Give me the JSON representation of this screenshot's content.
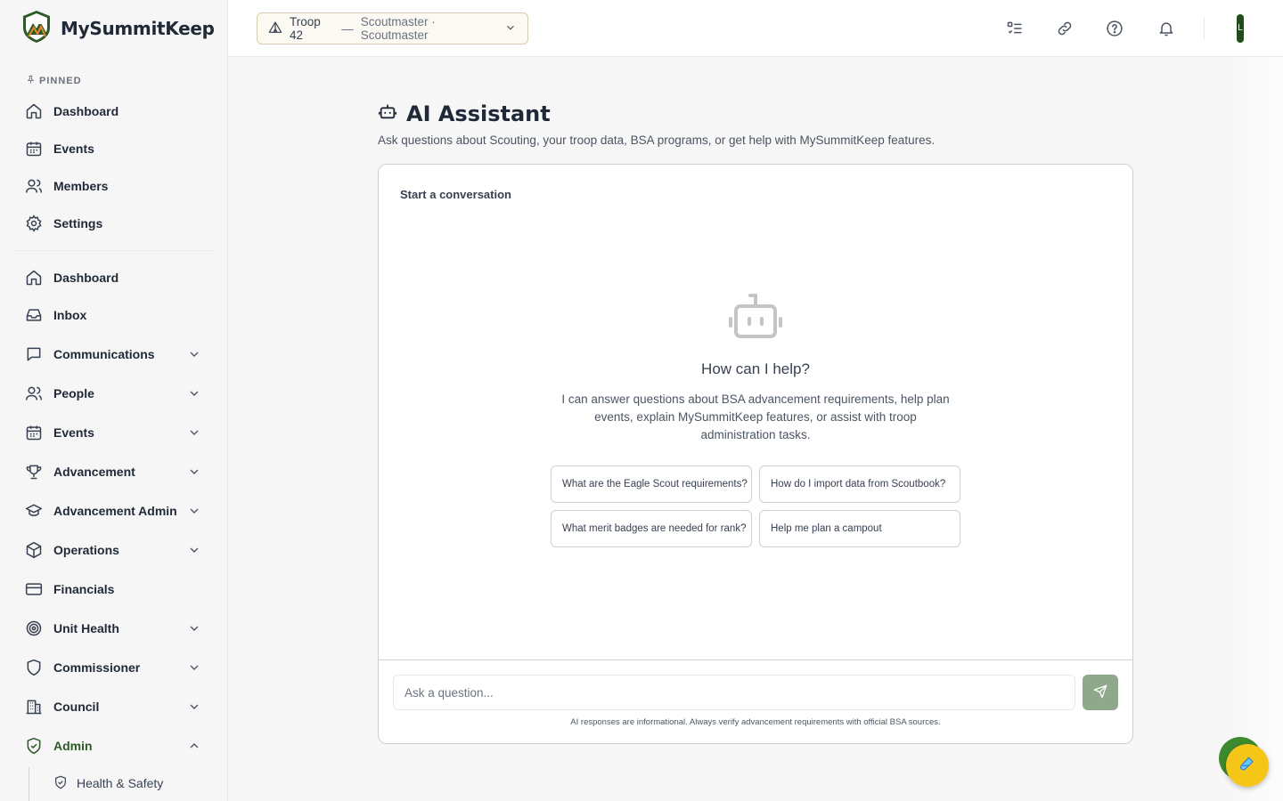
{
  "brand": {
    "name": "MySummitKeep"
  },
  "sidebar": {
    "pinned_label": "PINNED",
    "pinned": [
      {
        "label": "Dashboard",
        "icon": "home-icon"
      },
      {
        "label": "Events",
        "icon": "calendar-icon"
      },
      {
        "label": "Members",
        "icon": "users-icon"
      },
      {
        "label": "Settings",
        "icon": "gear-icon"
      }
    ],
    "items": [
      {
        "label": "Dashboard",
        "icon": "home-icon",
        "expandable": false
      },
      {
        "label": "Inbox",
        "icon": "inbox-icon",
        "expandable": false
      },
      {
        "label": "Communications",
        "icon": "message-icon",
        "expandable": true
      },
      {
        "label": "People",
        "icon": "users-icon",
        "expandable": true
      },
      {
        "label": "Events",
        "icon": "calendar-icon",
        "expandable": true
      },
      {
        "label": "Advancement",
        "icon": "trophy-icon",
        "expandable": true
      },
      {
        "label": "Advancement Admin",
        "icon": "graduation-cap-icon",
        "expandable": true
      },
      {
        "label": "Operations",
        "icon": "box-icon",
        "expandable": true
      },
      {
        "label": "Financials",
        "icon": "credit-card-icon",
        "expandable": false
      },
      {
        "label": "Unit Health",
        "icon": "target-icon",
        "expandable": true
      },
      {
        "label": "Commissioner",
        "icon": "shield-icon",
        "expandable": true
      },
      {
        "label": "Council",
        "icon": "building-icon",
        "expandable": true
      },
      {
        "label": "Admin",
        "icon": "shield-check-icon",
        "expandable": true,
        "expanded": true
      }
    ],
    "sub_items": [
      {
        "label": "Health & Safety",
        "icon": "shield-check-icon"
      }
    ]
  },
  "topbar": {
    "unit": "Troop 42",
    "unit_sep": "—",
    "unit_role": "Scoutmaster · Scoutmaster",
    "avatar_initial": "L"
  },
  "page": {
    "title": "AI Assistant",
    "subtitle": "Ask questions about Scouting, your troop data, BSA programs, or get help with MySummitKeep features."
  },
  "chat": {
    "section_title": "Start a conversation",
    "empty_heading": "How can I help?",
    "empty_text": "I can answer questions about BSA advancement requirements, help plan events, explain MySummitKeep features, or assist with troop administration tasks.",
    "suggestions": [
      "What are the Eagle Scout requirements?",
      "How do I import data from Scoutbook?",
      "What merit badges are needed for rank?",
      "Help me plan a campout"
    ],
    "input_placeholder": "Ask a question...",
    "disclaimer": "AI responses are informational. Always verify advancement requirements with official BSA sources."
  },
  "colors": {
    "brand_green": "#2d5a27",
    "send_button": "#8fa88b",
    "fab_yellow": "#f5c518",
    "fab_green": "#3e8a2e"
  }
}
